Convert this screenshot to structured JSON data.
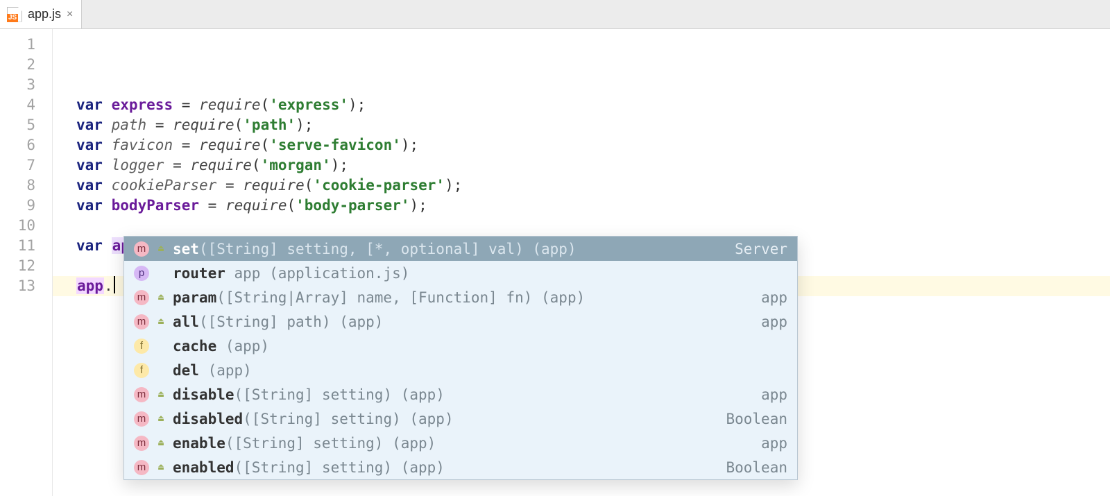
{
  "tab": {
    "filename": "app.js",
    "icon_badge": "JS"
  },
  "gutter": {
    "lines": [
      "1",
      "2",
      "3",
      "4",
      "5",
      "6",
      "7",
      "8",
      "9",
      "10",
      "11",
      "12",
      "13"
    ]
  },
  "code": {
    "lines": [
      {
        "kind": "require",
        "varName": "express",
        "varStyle": "strong",
        "module": "express"
      },
      {
        "kind": "require",
        "varName": "path",
        "varStyle": "italic",
        "module": "path"
      },
      {
        "kind": "require",
        "varName": "favicon",
        "varStyle": "italic",
        "module": "serve-favicon"
      },
      {
        "kind": "require",
        "varName": "logger",
        "varStyle": "italic",
        "module": "morgan"
      },
      {
        "kind": "require",
        "varName": "cookieParser",
        "varStyle": "italic",
        "module": "cookie-parser"
      },
      {
        "kind": "require",
        "varName": "bodyParser",
        "varStyle": "strong",
        "module": "body-parser"
      },
      {
        "kind": "blank"
      },
      {
        "kind": "assign-app"
      },
      {
        "kind": "blank"
      },
      {
        "kind": "app-dot-caret"
      },
      {
        "kind": "blank"
      },
      {
        "kind": "blank"
      },
      {
        "kind": "blank"
      }
    ],
    "kw_var": "var",
    "fn_require": "require",
    "app_ident": "app",
    "express_ident": "express"
  },
  "autocomplete": {
    "items": [
      {
        "kind": "m",
        "lock": true,
        "name": "set",
        "sig": "([String] setting, [*, optional] val) (app)",
        "ret": "Server",
        "selected": true
      },
      {
        "kind": "p",
        "lock": false,
        "name": "router",
        "sig": " app (application.js)",
        "ret": ""
      },
      {
        "kind": "m",
        "lock": true,
        "name": "param",
        "sig": "([String|Array] name, [Function] fn) (app)",
        "ret": "app"
      },
      {
        "kind": "m",
        "lock": true,
        "name": "all",
        "sig": "([String] path) (app)",
        "ret": "app"
      },
      {
        "kind": "f",
        "lock": false,
        "name": "cache",
        "sig": " (app)",
        "ret": ""
      },
      {
        "kind": "f",
        "lock": false,
        "name": "del",
        "sig": " (app)",
        "ret": ""
      },
      {
        "kind": "m",
        "lock": true,
        "name": "disable",
        "sig": "([String] setting) (app)",
        "ret": "app"
      },
      {
        "kind": "m",
        "lock": true,
        "name": "disabled",
        "sig": "([String] setting) (app)",
        "ret": "Boolean"
      },
      {
        "kind": "m",
        "lock": true,
        "name": "enable",
        "sig": "([String] setting) (app)",
        "ret": "app"
      },
      {
        "kind": "m",
        "lock": true,
        "name": "enabled",
        "sig": "([String] setting) (app)",
        "ret": "Boolean"
      }
    ]
  }
}
